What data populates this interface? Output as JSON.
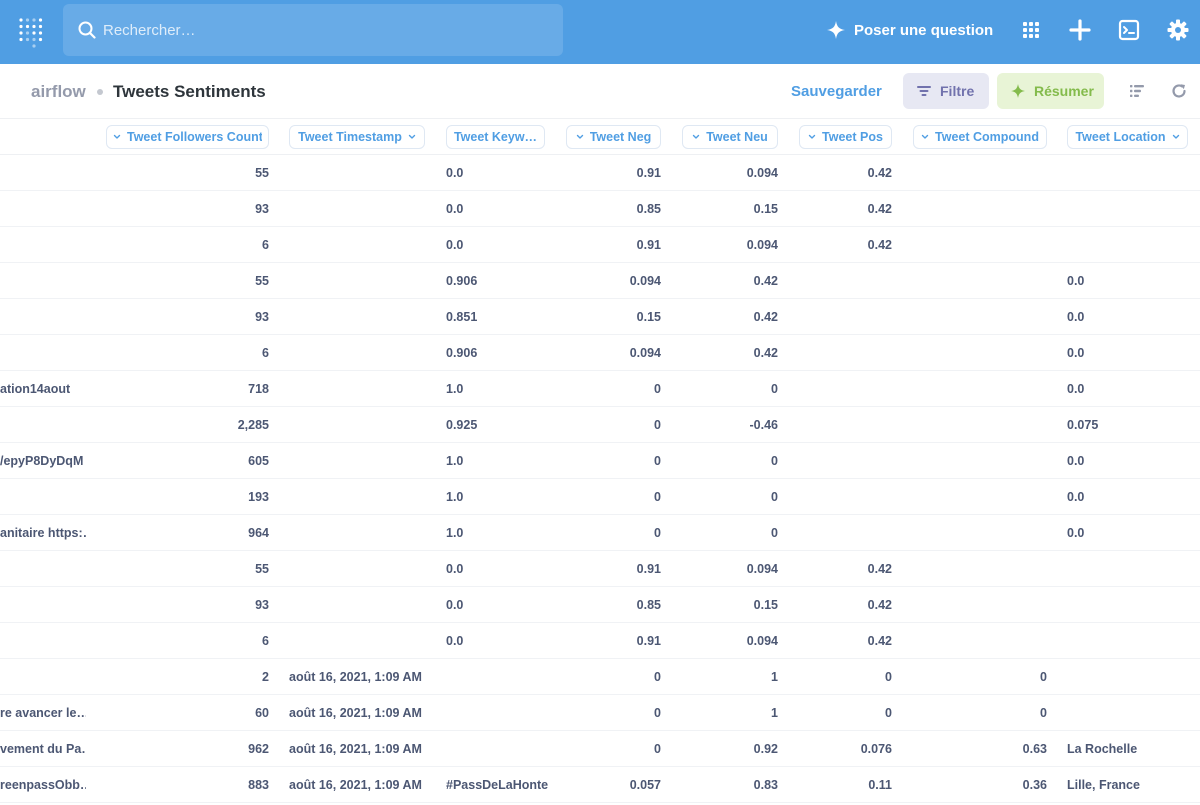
{
  "nav": {
    "search_placeholder": "Rechercher…",
    "ask_label": "Poser une question",
    "icons": [
      "logo-icon",
      "search-icon",
      "sparkle-icon",
      "grid-icon",
      "plus-icon",
      "sql-editor-icon",
      "gear-icon"
    ]
  },
  "header": {
    "database": "airflow",
    "title": "Tweets Sentiments",
    "save_label": "Sauvegarder",
    "filter_label": "Filtre",
    "summarize_label": "Résumer"
  },
  "columns": [
    "Tweet Followers Count",
    "Tweet Timestamp",
    "Tweet Keyw…",
    "Tweet Neg",
    "Tweet Neu",
    "Tweet Pos",
    "Tweet Compound",
    "Tweet Location"
  ],
  "rows": [
    [
      "",
      "55",
      "",
      "0.0",
      "0.91",
      "0.094",
      "0.42",
      "",
      ""
    ],
    [
      "",
      "93",
      "",
      "0.0",
      "0.85",
      "0.15",
      "0.42",
      "",
      ""
    ],
    [
      "",
      "6",
      "",
      "0.0",
      "0.91",
      "0.094",
      "0.42",
      "",
      ""
    ],
    [
      "",
      "55",
      "",
      "0.906",
      "0.094",
      "0.42",
      "",
      "",
      "0.0"
    ],
    [
      "",
      "93",
      "",
      "0.851",
      "0.15",
      "0.42",
      "",
      "",
      "0.0"
    ],
    [
      "",
      "6",
      "",
      "0.906",
      "0.094",
      "0.42",
      "",
      "",
      "0.0"
    ],
    [
      "ation14aout",
      "718",
      "",
      "1.0",
      "0",
      "0",
      "",
      "",
      "0.0"
    ],
    [
      "",
      "2,285",
      "",
      "0.925",
      "0",
      "-0.46",
      "",
      "",
      "0.075"
    ],
    [
      "/epyP8DyDqM",
      "605",
      "",
      "1.0",
      "0",
      "0",
      "",
      "",
      "0.0"
    ],
    [
      "",
      "193",
      "",
      "1.0",
      "0",
      "0",
      "",
      "",
      "0.0"
    ],
    [
      "anitaire https:…",
      "964",
      "",
      "1.0",
      "0",
      "0",
      "",
      "",
      "0.0"
    ],
    [
      "",
      "55",
      "",
      "0.0",
      "0.91",
      "0.094",
      "0.42",
      "",
      ""
    ],
    [
      "",
      "93",
      "",
      "0.0",
      "0.85",
      "0.15",
      "0.42",
      "",
      ""
    ],
    [
      "",
      "6",
      "",
      "0.0",
      "0.91",
      "0.094",
      "0.42",
      "",
      ""
    ],
    [
      "",
      "2",
      "août 16, 2021, 1:09 AM",
      "",
      "0",
      "1",
      "0",
      "0",
      ""
    ],
    [
      "re avancer le…",
      "60",
      "août 16, 2021, 1:09 AM",
      "",
      "0",
      "1",
      "0",
      "0",
      ""
    ],
    [
      "vement du Pa…",
      "962",
      "août 16, 2021, 1:09 AM",
      "",
      "0",
      "0.92",
      "0.076",
      "0.63",
      "La Rochelle"
    ],
    [
      "reenpassObb…",
      "883",
      "août 16, 2021, 1:09 AM",
      "#PassDeLaHonte",
      "0.057",
      "0.83",
      "0.11",
      "0.36",
      "Lille, France"
    ]
  ],
  "colors": {
    "brand": "#509ee3",
    "filter_bg": "#e7e8f3",
    "filter_text": "#7172ad",
    "summarize_bg": "#e8f4d6",
    "summarize_text": "#84bb4c",
    "text_dark": "#2e353b",
    "text_muted": "#949aab"
  }
}
